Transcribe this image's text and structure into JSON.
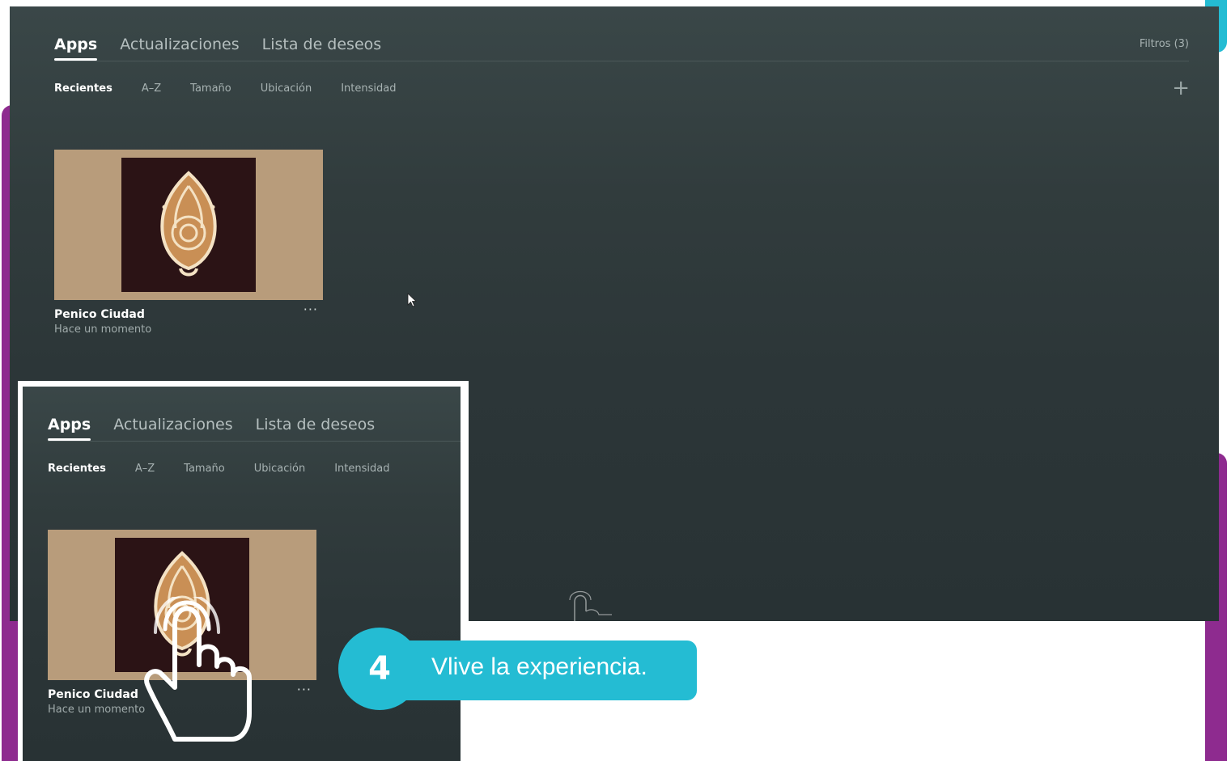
{
  "tabs": [
    {
      "label": "Apps",
      "active": true
    },
    {
      "label": "Actualizaciones",
      "active": false
    },
    {
      "label": "Lista de deseos",
      "active": false
    }
  ],
  "sort": [
    {
      "label": "Recientes",
      "active": true
    },
    {
      "label": "A–Z",
      "active": false
    },
    {
      "label": "Tamaño",
      "active": false
    },
    {
      "label": "Ubicación",
      "active": false
    },
    {
      "label": "Intensidad",
      "active": false
    }
  ],
  "filters_label": "Filtros (3)",
  "add_label": "+",
  "app_card": {
    "title": "Penico Ciudad",
    "subtitle": "Hace un momento",
    "more_label": "···",
    "icon": "conch-shell-icon"
  },
  "step": {
    "number": "4",
    "text": "Vlive la experiencia."
  },
  "colors": {
    "accent_purple": "#8e2b8f",
    "accent_teal": "#24bcd3",
    "thumb_bg": "#b89c7b",
    "thumb_inner": "#2b1315"
  }
}
